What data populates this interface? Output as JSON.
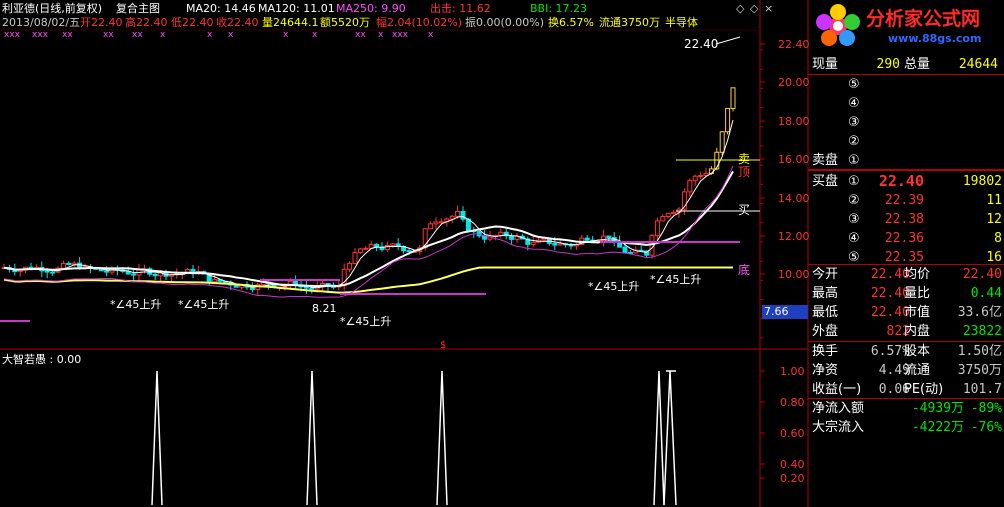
{
  "header": {
    "stock_name": "利亚德(日线,前复权)",
    "indicator_name": "复合主图",
    "ma20": "MA20: 14.46",
    "ma120": "MA120: 11.01",
    "ma250": "MA250: 9.90",
    "chuji": "出击: 11.62",
    "bbi": "BBI: 17.23",
    "date": "2013/08/02/五",
    "open": "开22.40",
    "high": "高22.40",
    "low": "低22.40",
    "close": "收22.40",
    "volume": "量24644.1",
    "amount": "额5520万",
    "range": "幅2.04(10.02%)",
    "amplitude": "振0.00(0.00%)",
    "turnover": "换6.57%",
    "float_shares": "流通3750万",
    "sector": "半导体",
    "marks": [
      "xxx",
      "xxx",
      "xx",
      "xx",
      "xx",
      "x",
      "x",
      "x",
      "x",
      "x",
      "xx",
      "x",
      "xxx",
      "x"
    ]
  },
  "top_right": {
    "prev": "◇",
    "next": "◇",
    "close": "×"
  },
  "logo": {
    "title": "分析家公式网",
    "url": "www.88gs.com"
  },
  "price_axis": {
    "ticks": [
      "22.40",
      "20.00",
      "18.00",
      "16.00",
      "14.00",
      "12.00",
      "10.00"
    ],
    "current_label": "7.66"
  },
  "annotations": {
    "top_price": "22.40",
    "sell": "卖",
    "top": "顶",
    "buy": "买",
    "bottom": "底",
    "low_price": "8.21",
    "angle_labels": [
      "*∠45上升",
      "*∠45上升",
      "*∠45上升",
      "*∠45上升",
      "*∠45上升"
    ],
    "dollar": "$"
  },
  "sub_panel": {
    "title": "大智若愚 : 0.00",
    "ticks": [
      "1.00",
      "0.80",
      "0.60",
      "0.40",
      "0.20"
    ]
  },
  "quote": {
    "now_label": "现量",
    "now_value": "290",
    "total_label": "总量",
    "total_value": "24644",
    "sell_label": "卖盘",
    "sell_levels": [
      "⑤",
      "④",
      "③",
      "②",
      "①"
    ],
    "buy_label": "买盘",
    "buy_levels": [
      {
        "lvl": "①",
        "price": "22.40",
        "vol": "19802"
      },
      {
        "lvl": "②",
        "price": "22.39",
        "vol": "11"
      },
      {
        "lvl": "③",
        "price": "22.38",
        "vol": "12"
      },
      {
        "lvl": "④",
        "price": "22.36",
        "vol": "8"
      },
      {
        "lvl": "⑤",
        "price": "22.35",
        "vol": "16"
      }
    ],
    "stats": [
      {
        "l1": "今开",
        "v1": "22.40",
        "l2": "均价",
        "v2": "22.40",
        "c1": "red",
        "c2": "red"
      },
      {
        "l1": "最高",
        "v1": "22.40",
        "l2": "量比",
        "v2": "0.44",
        "c1": "red",
        "c2": "grn"
      },
      {
        "l1": "最低",
        "v1": "22.40",
        "l2": "市值",
        "v2": "33.6亿",
        "c1": "red",
        "c2": "gry"
      },
      {
        "l1": "外盘",
        "v1": "822",
        "l2": "内盘",
        "v2": "23822",
        "c1": "red",
        "c2": "grn"
      }
    ],
    "stats2": [
      {
        "l1": "换手",
        "v1": "6.57%",
        "l2": "股本",
        "v2": "1.50亿"
      },
      {
        "l1": "净资",
        "v1": "4.49",
        "l2": "流通",
        "v2": "3750万"
      },
      {
        "l1": "收益(一)",
        "v1": "0.06",
        "l2": "PE(动)",
        "v2": "101.7"
      }
    ],
    "flows": [
      {
        "label": "净流入额",
        "value": "-4939万",
        "pct": "-89%"
      },
      {
        "label": "大宗流入",
        "value": "-4222万",
        "pct": "-76%"
      }
    ]
  },
  "colors": {
    "up": "#ff3232",
    "down": "#00e6e6",
    "ma_white": "#ffffff",
    "ma_yellow": "#ffff66",
    "ma_purple": "#cc33cc",
    "grid_red": "#b30000"
  }
}
